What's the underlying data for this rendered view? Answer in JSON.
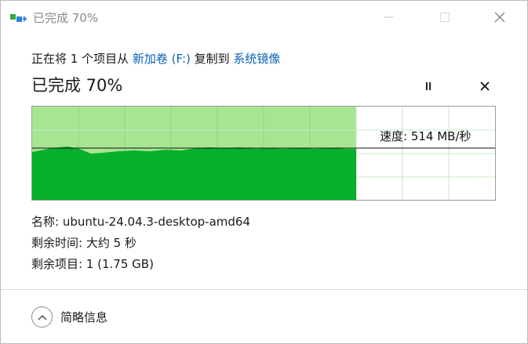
{
  "window": {
    "title": "已完成 70%",
    "icon": "file-copy-icon"
  },
  "progress": {
    "source_prefix": "正在将 1 个项目从 ",
    "source_name": "新加卷 (F:)",
    "middle_text": " 复制到 ",
    "destination_name": "系统镜像",
    "status_heading": "已完成 70%",
    "fraction_complete": 0.7,
    "speed_text": "速度: 514 MB/秒"
  },
  "details": {
    "name_line": "名称:  ubuntu-24.04.3-desktop-amd64",
    "time_line": "剩余时间:  大约 5 秒",
    "items_line": "剩余项目:  1 (1.75 GB)"
  },
  "footer": {
    "toggle_label": "简略信息"
  },
  "colors": {
    "graph_fill": "#06b02a",
    "graph_done": "#a8e592",
    "grid_line": "#c9e8c6",
    "link": "#0b62b8"
  }
}
